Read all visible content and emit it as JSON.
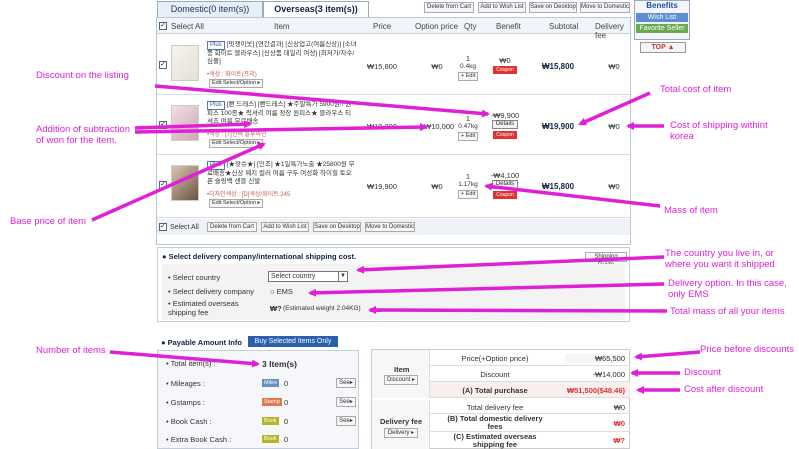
{
  "tabs": {
    "domestic": "Domestic(0 item(s))",
    "overseas": "Overseas(3 item(s))"
  },
  "toolbar": {
    "delete": "Delete from Cart",
    "wishlist": "Add to Wish List",
    "desktop": "Save on Desktop",
    "domestic": "Move to Domestic"
  },
  "side": {
    "title": "Benefits",
    "wish": "Wish List",
    "fav": "Favorite Seller",
    "top": "TOP ▲"
  },
  "header": {
    "select_all": "Select All",
    "item": "Item",
    "price": "Price",
    "option_price": "Option price",
    "qty": "Qty",
    "benefit": "Benefit",
    "subtotal": "Subtotal",
    "delivery_fee": "Delivery fee"
  },
  "items": [
    {
      "plus": "Plus",
      "title": "[멋쟁이옷] [연간결과] [신상업고(여름신상)] [소녀풍 화이트 블라우스] [신상품 데일리 여성] [최저가/자수/심플]",
      "option": "•색상 : 화이트(프리)",
      "edit": "Edit Select/Option ▸",
      "price": "₩15,800",
      "option_price": "₩0",
      "qty": "1",
      "weight": "0.4kg",
      "qty_edit": "+ Edit",
      "benefit": "₩0",
      "coupon": "Coupon like",
      "subtotal": "₩15,800",
      "delivery": "₩0"
    },
    {
      "plus": "Plus",
      "title": "[빤 드레스] [빤드레스] ★주말특가 5900원!! 원피스 100종★ 럭셔리 여름 정장 원피스★ 블라우스 티셔츠 여름 무료배송",
      "option": "•색상 : [7]선택 블루와인",
      "edit": "Edit Select/Option ▸",
      "price": "₩19,800",
      "option_price": "+₩10,000",
      "qty": "1",
      "weight": "0.47kg",
      "qty_edit": "+ Edit",
      "benefit": "-₩9,900",
      "details": "Details",
      "coupon": "Coupon like",
      "subtotal": "₩19,900",
      "delivery": "₩0"
    },
    {
      "plus": "Plus",
      "title": "[★핫슈★] [인조] ★1일특가노출 ★25800원 무료배송★신상 웨지 컬러 여름 구두 여성화 하이힐 토오픈 슬링백 샌들 신발",
      "option": "•디자인색상 : [D]색상/화이트 245",
      "edit": "Edit Select/Option ▸",
      "price": "₩19,900",
      "option_price": "₩0",
      "qty": "1",
      "weight": "1.17kg",
      "qty_edit": "+ Edit",
      "benefit": "-₩4,100",
      "details": "Details",
      "coupon": "Coupon like",
      "subtotal": "₩15,800",
      "delivery": "₩0"
    }
  ],
  "bottom_bar": {
    "select_all": "Select All",
    "delete": "Delete from Cart",
    "wishlist": "Add to Wish List",
    "desktop": "Save on Desktop",
    "domestic": "Move to Domestic"
  },
  "delivery": {
    "heading": "Select delivery company/international shipping cost.",
    "guide": "Shipping Guide",
    "country_label": "Select country",
    "country_value": "Select country",
    "company_label": "Select delivery company",
    "company_value": "EMS",
    "fee_label": "Estimated overseas shipping fee",
    "fee_value": "₩?",
    "fee_note": "(Estimated weight 2.04KG)"
  },
  "payable": {
    "heading": "Payable Amount Info",
    "buy": "Buy Selected Items Only",
    "total_items_label": "Total item(s) :",
    "total_items_value": "3 Item(s)",
    "mileage_label": "Mileages :",
    "mileage_badge": "Miles",
    "mileage_value": "0",
    "gstamp_label": "Gstamps :",
    "gstamp_badge": "Stamp",
    "gstamp_value": "0",
    "bookcash_label": "Book Cash :",
    "bookcash_badge": "Book",
    "bookcash_value": "0",
    "extra_label": "Extra Book Cash :",
    "extra_badge": "Book",
    "extra_value": "0",
    "see": "See▸"
  },
  "summary": {
    "item": "Item",
    "discount_btn": "Discount ▸",
    "price_label": "Price(+Option price)",
    "price_value": "₩65,500",
    "discount_label": "Discount",
    "discount_value": "-₩14,000",
    "total_label": "(A) Total purchase",
    "total_value": "₩51,500($48.46)",
    "delivery_label": "Delivery fee",
    "delivery_btn": "Delivery ▸",
    "total_delivery_label": "Total delivery fee",
    "total_delivery_value": "₩0",
    "domestic_label": "(B) Total domestic delivery fees",
    "domestic_value": "₩0",
    "overseas_label": "(C) Estimated overseas shipping fee",
    "overseas_value": "₩?"
  },
  "annotations": {
    "discount": "Discount on the listing",
    "addition": "Addition of subtraction of won for the item.",
    "total_cost": "Total cost of item",
    "shipping_korea": "Cost of shipping withint korea",
    "base_price": "Base price of item",
    "mass": "Mass of item",
    "country": "The country you live in, or where you want it shipped",
    "delivery_opt": "Delivery option. In this case, only EMS",
    "total_mass": "Total mass of all your items",
    "num_items": "Number of items",
    "price_before": "Price before discounts",
    "discount2": "Discount",
    "cost_after": "Cost after discount"
  },
  "colors": {
    "annotation": "#e020d8",
    "accent": "#1f4fa0",
    "coupon": "#d33"
  }
}
